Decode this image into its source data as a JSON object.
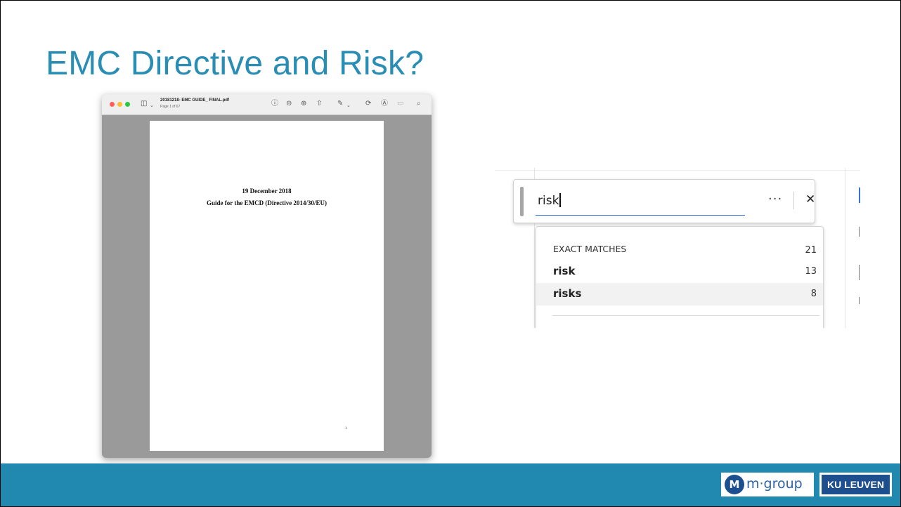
{
  "slide": {
    "title": "EMC Directive and Risk?"
  },
  "pdf_viewer": {
    "file_name": "20181218- EMC GUIDE_ FINAL.pdf",
    "page_info": "Page 1 of 67",
    "toolbar_icons": [
      "sidebar-icon",
      "chevron-down-icon",
      "info-icon",
      "zoom-out-icon",
      "zoom-in-icon",
      "share-icon",
      "markup-pen-icon",
      "rotate-icon",
      "annotate-icon",
      "form-icon",
      "search-icon"
    ],
    "document": {
      "date": "19 December 2018",
      "title": "Guide for the EMCD (Directive 2014/30/EU)",
      "page_number": "1"
    }
  },
  "find_panel": {
    "query": "risk",
    "more_label": "···",
    "close_label": "✕",
    "matches": {
      "header_label": "EXACT MATCHES",
      "header_count": "21",
      "items": [
        {
          "term": "risk",
          "count": "13"
        },
        {
          "term": "risks",
          "count": "8"
        }
      ]
    }
  },
  "footer": {
    "mgroup_badge": "M",
    "mgroup_label": "m·group",
    "kuleuven_label": "KU LEUVEN",
    "band_color": "#2189b0"
  },
  "colors": {
    "title": "#2a8db4",
    "accent_blue": "#2b6fd6"
  }
}
